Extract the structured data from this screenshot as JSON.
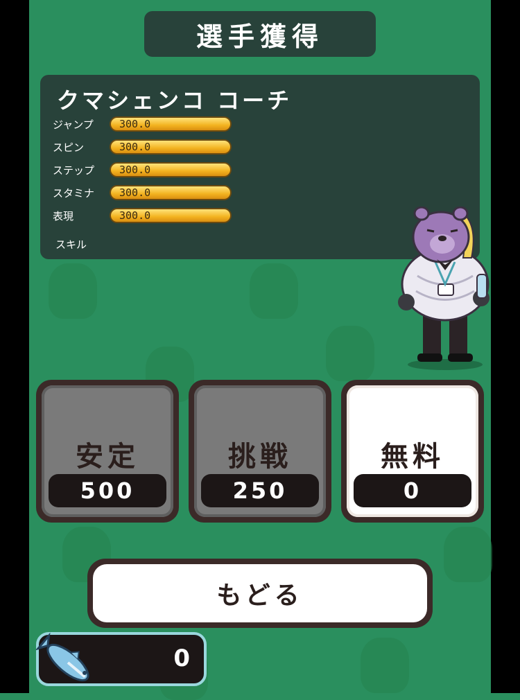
{
  "header": {
    "title": "選手獲得"
  },
  "coach": {
    "name": "クマシェンコ コーチ",
    "stats": [
      {
        "label": "ジャンプ",
        "value": "300.0"
      },
      {
        "label": "スピン",
        "value": "300.0"
      },
      {
        "label": "ステップ",
        "value": "300.0"
      },
      {
        "label": "スタミナ",
        "value": "300.0"
      },
      {
        "label": "表現",
        "value": "300.0"
      }
    ],
    "skill_label": "スキル"
  },
  "choices": [
    {
      "label": "安定",
      "cost": "500"
    },
    {
      "label": "挑戦",
      "cost": "250"
    },
    {
      "label": "無料",
      "cost": "0"
    }
  ],
  "back_button": {
    "label": "もどる"
  },
  "currency": {
    "icon": "fish-icon",
    "value": "0"
  },
  "colors": {
    "background": "#2a8f5e",
    "panel": "#28423a",
    "stat_bar": "#f3b320"
  }
}
